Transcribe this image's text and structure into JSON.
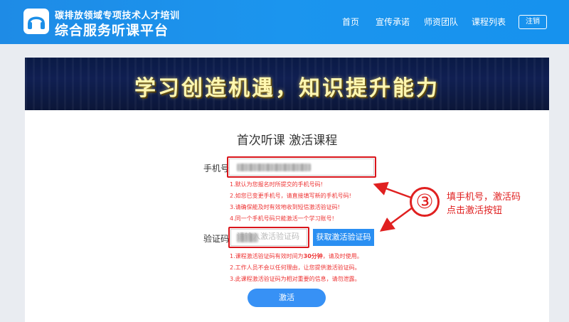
{
  "header": {
    "brand_line1": "碳排放领域专项技术人才培训",
    "brand_line2": "综合服务听课平台",
    "nav": [
      "首页",
      "宣传承诺",
      "师资团队",
      "课程列表"
    ],
    "logout_label": "注销"
  },
  "banner": {
    "text": "学习创造机遇，知识提升能力"
  },
  "form": {
    "title": "首次听课 激活课程",
    "phone_label": "手机号",
    "phone_hints": [
      "1.默认为您报名时所提交的手机号码!",
      "2.如您已变更手机号，请直接填写新的手机号码!",
      "3.请确保能及时有效地收到短信激活验证码!",
      "4.同一个手机号码只能激活一个学习账号!"
    ],
    "code_label": "验证码",
    "code_placeholder": "请输入激活验证码",
    "get_code_label": "获取激活验证码",
    "code_hints_prefix": "1.课程激活验证码有效时间为",
    "code_hints_bold": "30分钟",
    "code_hints_suffix": "，请及时使用。",
    "code_hints": [
      "2.工作人员不会以任何理由，让您提供激活验证码。",
      "3.此课程激活验证码为相对重要的信息，请勿泄露。"
    ],
    "submit_label": "激活"
  },
  "annotation": {
    "number": "③",
    "line1": "填手机号，激活码",
    "line2": "点击激活按钮"
  },
  "colors": {
    "header": "#1b95ee",
    "accent_red": "#d9151b",
    "button_blue": "#2a8ff2"
  }
}
